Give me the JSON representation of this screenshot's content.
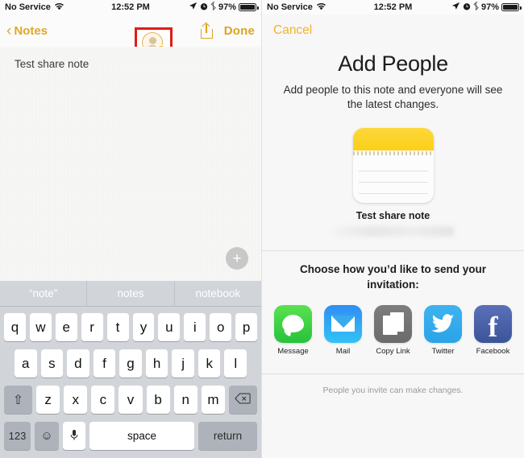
{
  "status_bar": {
    "carrier": "No Service",
    "wifi_icon": "wifi-icon",
    "time": "12:52 PM",
    "location_icon": "location-arrow-icon",
    "alarm_icon": "alarm-clock-icon",
    "bluetooth_icon": "bluetooth-icon",
    "battery_percent": "97%",
    "battery_level": 97
  },
  "left_panel": {
    "nav": {
      "back_label": "Notes",
      "back_icon": "chevron-left-icon",
      "add_person_icon": "add-person-icon",
      "share_icon": "share-upload-icon",
      "done_label": "Done",
      "highlight_color": "#e01b18"
    },
    "note": {
      "text": "Test share note",
      "add_button_icon": "plus-icon"
    },
    "keyboard": {
      "predictions": [
        "“note”",
        "notes",
        "notebook"
      ],
      "row1": [
        "q",
        "w",
        "e",
        "r",
        "t",
        "y",
        "u",
        "i",
        "o",
        "p"
      ],
      "row2": [
        "a",
        "s",
        "d",
        "f",
        "g",
        "h",
        "j",
        "k",
        "l"
      ],
      "row3": [
        "z",
        "x",
        "c",
        "v",
        "b",
        "n",
        "m"
      ],
      "shift_icon": "shift-arrow-icon",
      "delete_icon": "delete-backspace-icon",
      "numbers_label": "123",
      "emoji_icon": "smiley-face-icon",
      "mic_icon": "microphone-icon",
      "space_label": "space",
      "return_label": "return"
    }
  },
  "right_panel": {
    "cancel_label": "Cancel",
    "title": "Add People",
    "subtitle": "Add people to this note and everyone will see the latest changes.",
    "note_thumb": {
      "title": "Test share note",
      "icon": "note-document-icon"
    },
    "choose_text": "Choose how you’d like to send your invitation:",
    "share_options": [
      {
        "label": "Message",
        "icon": "message-bubble-icon",
        "color": "#32c93c"
      },
      {
        "label": "Mail",
        "icon": "mail-envelope-icon",
        "color": "#33aaf0"
      },
      {
        "label": "Copy Link",
        "icon": "copy-pages-icon",
        "color": "#6f6f6f"
      },
      {
        "label": "Twitter",
        "icon": "twitter-bird-icon",
        "color": "#2faae8"
      },
      {
        "label": "Facebook",
        "icon": "facebook-f-icon",
        "color": "#3b5499"
      }
    ],
    "footer_note": "People you invite can make changes."
  }
}
